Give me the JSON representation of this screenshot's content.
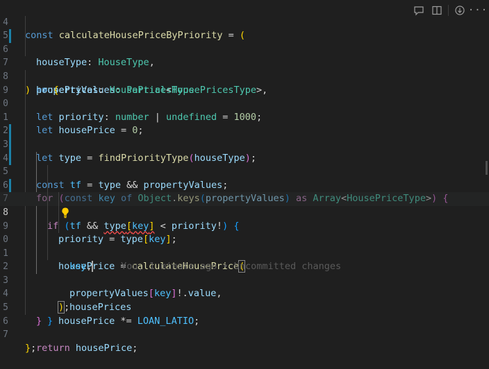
{
  "editor": {
    "lines": [
      {
        "num": "4"
      },
      {
        "num": "5"
      },
      {
        "num": "6"
      },
      {
        "num": "7"
      },
      {
        "num": "8"
      },
      {
        "num": "9"
      },
      {
        "num": "0"
      },
      {
        "num": "1"
      },
      {
        "num": "2"
      },
      {
        "num": "3"
      },
      {
        "num": "4"
      },
      {
        "num": "5"
      },
      {
        "num": "6"
      },
      {
        "num": "7"
      },
      {
        "num": "8"
      },
      {
        "num": "9"
      },
      {
        "num": "0"
      },
      {
        "num": "1"
      },
      {
        "num": "2"
      },
      {
        "num": "3"
      },
      {
        "num": "4"
      },
      {
        "num": "5"
      },
      {
        "num": "6"
      },
      {
        "num": "7"
      }
    ],
    "code": {
      "l1": {
        "kw": "const",
        "name": "calculateHousePriceByPriority",
        "eq": " = ",
        "paren": "("
      },
      "l2": {
        "param": "houseType",
        "colon": ": ",
        "type": "HouseType",
        "comma": ","
      },
      "l3": {
        "param": "propertyValues",
        "colon": ": ",
        "type": "Partial",
        "lt": "<",
        "type2": "HousePricesType",
        "gt": ">",
        "comma": ","
      },
      "l4": {
        "param": "housePrices",
        "colon": ": ",
        "type": "HousePricesType"
      },
      "l5": {
        "paren": ")",
        "arrow": " => ",
        "brace": "{"
      },
      "l6": {
        "kw": "let",
        "name": "priority",
        "colon": ": ",
        "type": "number",
        "bar": " | ",
        "type2": "undefined",
        "eq": " = ",
        "num": "1000",
        "semi": ";"
      },
      "l7": {
        "kw": "let",
        "name": "housePrice",
        "eq": " = ",
        "num": "0",
        "semi": ";"
      },
      "l9": {
        "kw": "let",
        "name": "type",
        "eq": " = ",
        "fn": "findPriorityType",
        "po": "(",
        "arg": "houseType",
        "pc": ")",
        "semi": ";"
      },
      "l10": {
        "kw": "const",
        "name": "tf",
        "eq": " = ",
        "a": "type",
        "and": " && ",
        "b": "propertyValues",
        "semi": ";"
      },
      "l11": {
        "kw": "for",
        "po": " (",
        "kw2": "const",
        "key": "key",
        "of": " of ",
        "obj": "Object",
        "dot": ".",
        "fn": "keys",
        "p2o": "(",
        "arg": "propertyValues",
        "p2c": ")",
        "as": " as ",
        "type": "Array",
        "lt": "<",
        "type2": "HousePriceType",
        "gt": ">",
        "pc": ")",
        "brace": " {"
      },
      "l12": {
        "kw": "if",
        "po": " (",
        "a": "tf",
        "and": " && ",
        "b": "type",
        "bo": "[",
        "key": "key",
        "bc": "]",
        "lt": " < ",
        "c": "priority",
        "bang": "!",
        "pc": ")",
        "brace": " {"
      },
      "l13": {
        "a": "priority",
        "eq": " = ",
        "b": "type",
        "bo": "[",
        "key": "key",
        "bc": "]",
        "semi": ";"
      },
      "l14": {
        "a": "housePrice",
        "eq": " = ",
        "fn": "calculateHousePrice",
        "po": "("
      },
      "l15": {
        "key": "key",
        "comma": ",",
        "blame": "You, 1 minute ago • Uncommitted changes"
      },
      "l16": {
        "a": "propertyValues",
        "bo": "[",
        "key": "key",
        "bc": "]",
        "bang": "!",
        "dot": ".",
        "prop": "value",
        "comma": ","
      },
      "l17": {
        "a": "housePrices"
      },
      "l18": {
        "pc": ")",
        "semi": ";"
      },
      "l19": {
        "a": "housePrice",
        "op": " *= ",
        "cst": "LOAN_LATIO",
        "semi": ";"
      },
      "l20": {
        "brace": "}"
      },
      "l21": {
        "brace": "}"
      },
      "l23": {
        "kw": "return",
        "a": "housePrice",
        "semi": ";"
      },
      "l24": {
        "brace": "}",
        "semi": ";"
      }
    }
  },
  "toolbar": {
    "icons": [
      "comment-icon",
      "split-editor-icon",
      "compare-icon",
      "more-icon"
    ],
    "more": "···"
  },
  "colors": {
    "background": "#1f1f1f",
    "keyword": "#569cd6",
    "control": "#c586c0",
    "variable": "#9cdcfe",
    "type": "#4ec9b0",
    "function": "#dcdcaa",
    "number": "#b5cea8",
    "constant": "#4fc1ff",
    "bracket1": "#ffd700",
    "bracket2": "#da70d6",
    "bracket3": "#179fff"
  }
}
